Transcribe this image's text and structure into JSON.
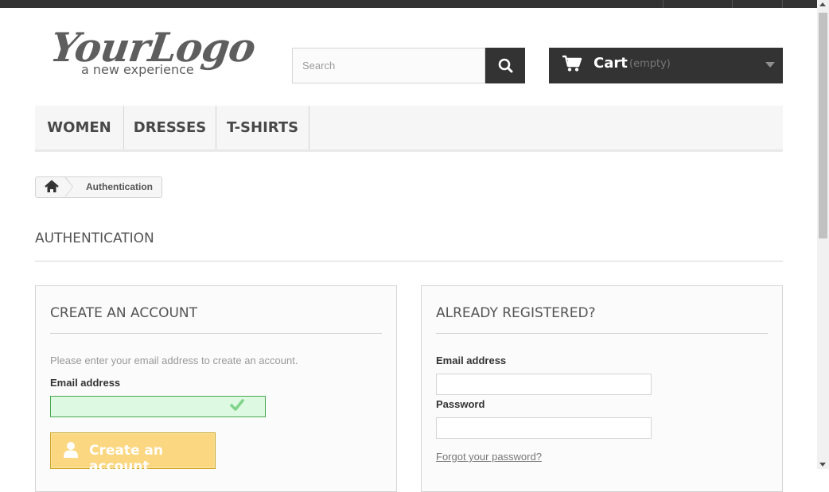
{
  "header": {
    "logo": {
      "word": "YourLogo",
      "tagline": "a new experience"
    },
    "search": {
      "placeholder": "Search"
    },
    "cart": {
      "label": "Cart",
      "status": "(empty)"
    }
  },
  "menu": {
    "items": [
      "WOMEN",
      "DRESSES",
      "T-SHIRTS"
    ]
  },
  "breadcrumb": {
    "current": "Authentication"
  },
  "page": {
    "title": "AUTHENTICATION"
  },
  "create_account": {
    "title": "CREATE AN ACCOUNT",
    "description": "Please enter your email address to create an account.",
    "email_label": "Email address",
    "email_value": "",
    "button_label": "Create an account"
  },
  "login": {
    "title": "ALREADY REGISTERED?",
    "email_label": "Email address",
    "password_label": "Password",
    "forgot_link": "Forgot your password?"
  },
  "colors": {
    "dark": "#333333",
    "button_yellow": "#fcd781",
    "valid_green": "#ddf9e1"
  }
}
